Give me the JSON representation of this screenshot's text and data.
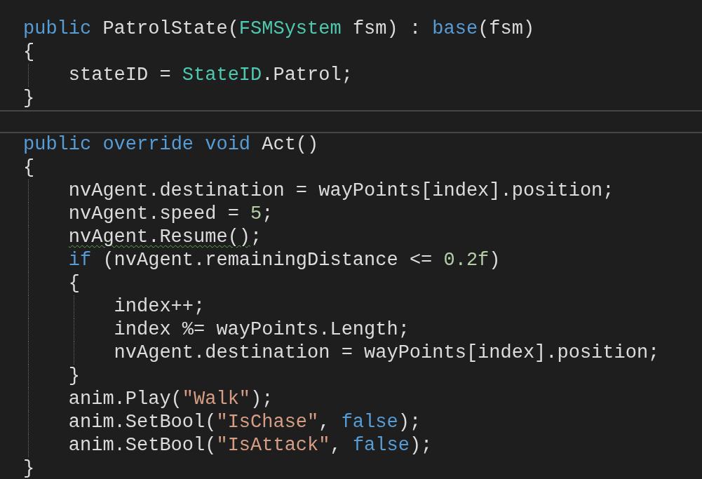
{
  "editor": {
    "lines": [
      {
        "current": false,
        "tokens": [
          {
            "text": "public ",
            "kind": "keyword"
          },
          {
            "text": "PatrolState(",
            "kind": "plain"
          },
          {
            "text": "FSMSystem",
            "kind": "type"
          },
          {
            "text": " fsm) : ",
            "kind": "plain"
          },
          {
            "text": "base",
            "kind": "keyword"
          },
          {
            "text": "(fsm)",
            "kind": "plain"
          }
        ]
      },
      {
        "current": false,
        "tokens": [
          {
            "text": "{",
            "kind": "plain"
          }
        ]
      },
      {
        "current": false,
        "tokens": [
          {
            "text": "    stateID = ",
            "kind": "plain"
          },
          {
            "text": "StateID",
            "kind": "type"
          },
          {
            "text": ".Patrol;",
            "kind": "plain"
          }
        ]
      },
      {
        "current": false,
        "tokens": [
          {
            "text": "}",
            "kind": "plain"
          }
        ]
      },
      {
        "current": true
      },
      {
        "current": false,
        "tokens": [
          {
            "text": "public override void ",
            "kind": "keyword"
          },
          {
            "text": "Act()",
            "kind": "plain"
          }
        ]
      },
      {
        "current": false,
        "tokens": [
          {
            "text": "{",
            "kind": "plain"
          }
        ]
      },
      {
        "current": false,
        "tokens": [
          {
            "text": "    nvAgent.destination = wayPoints[index].position;",
            "kind": "plain"
          }
        ]
      },
      {
        "current": false,
        "tokens": [
          {
            "text": "    nvAgent.speed = ",
            "kind": "plain"
          },
          {
            "text": "5",
            "kind": "number"
          },
          {
            "text": ";",
            "kind": "plain"
          }
        ]
      },
      {
        "current": false,
        "tokens": [
          {
            "text": "    nvAgent.Resume()",
            "kind": "plain",
            "squiggle": true
          },
          {
            "text": ";",
            "kind": "plain"
          }
        ]
      },
      {
        "current": false,
        "tokens": [
          {
            "text": "    if",
            "kind": "keyword"
          },
          {
            "text": " (nvAgent.remainingDistance <= ",
            "kind": "plain"
          },
          {
            "text": "0.2f",
            "kind": "number"
          },
          {
            "text": ")",
            "kind": "plain"
          }
        ]
      },
      {
        "current": false,
        "tokens": [
          {
            "text": "    {",
            "kind": "plain"
          }
        ]
      },
      {
        "current": false,
        "tokens": [
          {
            "text": "        index++;",
            "kind": "plain"
          }
        ]
      },
      {
        "current": false,
        "tokens": [
          {
            "text": "        index %= wayPoints.Length;",
            "kind": "plain"
          }
        ]
      },
      {
        "current": false,
        "tokens": [
          {
            "text": "        nvAgent.destination = wayPoints[index].position;",
            "kind": "plain"
          }
        ]
      },
      {
        "current": false,
        "tokens": [
          {
            "text": "    }",
            "kind": "plain"
          }
        ]
      },
      {
        "current": false,
        "tokens": [
          {
            "text": "    anim.Play(",
            "kind": "plain"
          },
          {
            "text": "\"Walk\"",
            "kind": "string"
          },
          {
            "text": ");",
            "kind": "plain"
          }
        ]
      },
      {
        "current": false,
        "tokens": [
          {
            "text": "    anim.SetBool(",
            "kind": "plain"
          },
          {
            "text": "\"IsChase\"",
            "kind": "string"
          },
          {
            "text": ", ",
            "kind": "plain"
          },
          {
            "text": "false",
            "kind": "keyword"
          },
          {
            "text": ");",
            "kind": "plain"
          }
        ]
      },
      {
        "current": false,
        "tokens": [
          {
            "text": "    anim.SetBool(",
            "kind": "plain"
          },
          {
            "text": "\"IsAttack\"",
            "kind": "string"
          },
          {
            "text": ", ",
            "kind": "plain"
          },
          {
            "text": "false",
            "kind": "keyword"
          },
          {
            "text": ");",
            "kind": "plain"
          }
        ]
      },
      {
        "current": false,
        "tokens": [
          {
            "text": "}",
            "kind": "plain"
          }
        ]
      }
    ]
  }
}
